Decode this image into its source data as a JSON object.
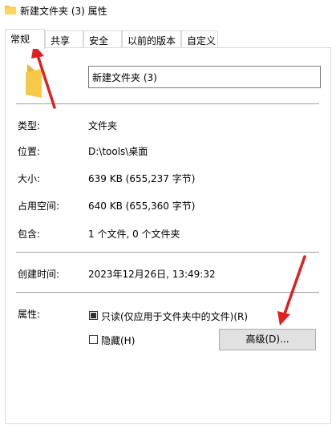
{
  "window": {
    "title": "新建文件夹 (3) 属性"
  },
  "tabs": [
    {
      "label": "常规",
      "active": true
    },
    {
      "label": "共享",
      "active": false
    },
    {
      "label": "安全",
      "active": false
    },
    {
      "label": "以前的版本",
      "active": false
    },
    {
      "label": "自定义",
      "active": false
    }
  ],
  "general": {
    "name_value": "新建文件夹 (3)",
    "type_label": "类型:",
    "type_value": "文件夹",
    "location_label": "位置:",
    "location_value": "D:\\tools\\桌面",
    "size_label": "大小:",
    "size_value": "639 KB (655,237 字节)",
    "size_on_disk_label": "占用空间:",
    "size_on_disk_value": "640 KB (655,360 字节)",
    "contains_label": "包含:",
    "contains_value": "1 个文件, 0 个文件夹",
    "created_label": "创建时间:",
    "created_value": "2023年12月26日, 13:49:32",
    "attributes_label": "属性:",
    "readonly_label": "只读(仅应用于文件夹中的文件)(R)",
    "readonly_checked": true,
    "hidden_label": "隐藏(H)",
    "hidden_checked": false,
    "advanced_button": "高级(D)..."
  },
  "colors": {
    "folder": "#f5c342",
    "annotation_arrow": "#e02020"
  },
  "icons": {
    "title_icon": "folder-icon",
    "big_icon": "folder-icon"
  }
}
